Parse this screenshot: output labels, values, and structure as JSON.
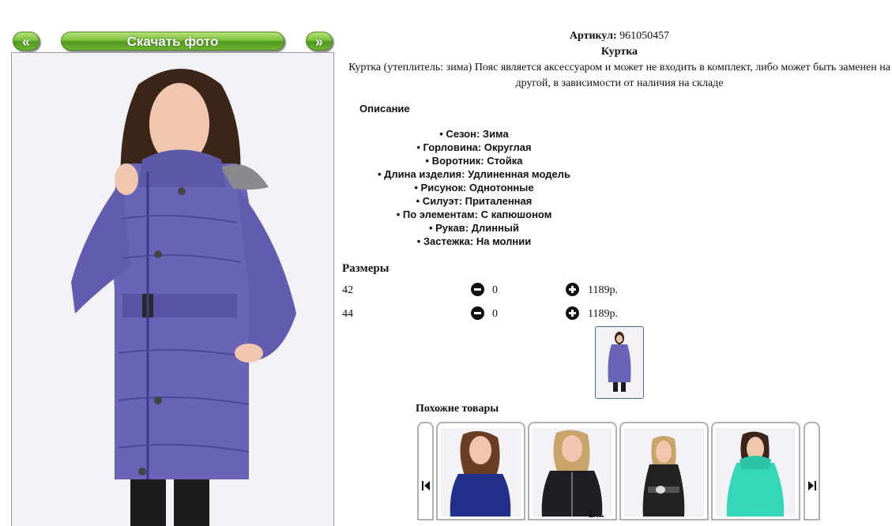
{
  "nav": {
    "prev_label": "«",
    "download_label": "Скачать фото",
    "next_label": "»"
  },
  "product": {
    "article_label": "Артикул:",
    "article_value": "961050457",
    "title": "Куртка",
    "description": "Куртка (утеплитель: зима) Пояс является аксессуаром и может не входить в комплект, либо может быть заменен на другой, в зависимости от наличия на складе",
    "description_heading": "Описание",
    "attributes": [
      "• Сезон: Зима",
      "• Горловина: Округлая",
      "• Воротник: Стойка",
      "• Длина изделия: Удлиненная модель",
      "• Рисунок: Однотонные",
      "• Силуэт: Приталенная",
      "• По элементам: С капюшоном",
      "• Рукав: Длинный",
      "• Застежка: На молнии"
    ],
    "main_color": "#6a64b8"
  },
  "sizes": {
    "heading": "Размеры",
    "rows": [
      {
        "size": "42",
        "qty": "0",
        "price": "1189р."
      },
      {
        "size": "44",
        "qty": "0",
        "price": "1189р."
      }
    ]
  },
  "similar": {
    "heading": "Похожие товары",
    "items": [
      {
        "icon": "navy-jacket-photo",
        "color": "#22308a"
      },
      {
        "icon": "black-jacket-photo",
        "color": "#1e1f24"
      },
      {
        "icon": "black-belted-jacket-photo",
        "color": "#222222"
      },
      {
        "icon": "turquoise-jacket-photo",
        "color": "#34d8b8"
      }
    ]
  },
  "bottom_cut_text": "Б..."
}
